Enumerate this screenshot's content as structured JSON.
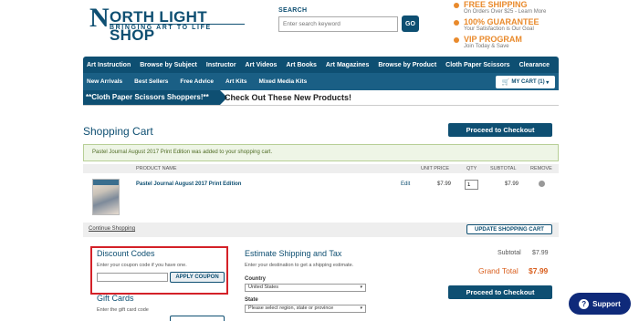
{
  "header": {
    "logo_letter": "N",
    "logo_title": "ORTH LIGHT SHOP",
    "logo_tagline": "BRINGING ART TO LIFE",
    "search_label": "SEARCH",
    "search_placeholder": "Enter search keyword",
    "search_button": "GO"
  },
  "promos": [
    {
      "title": "FREE SHIPPING",
      "sub": "On Orders Over $25 - Learn More"
    },
    {
      "title": "100% GUARANTEE",
      "sub": "Your Satisfaction is Our Goal"
    },
    {
      "title": "VIP PROGRAM",
      "sub": "Join Today & Save"
    }
  ],
  "nav_primary": [
    "Art Instruction",
    "Browse by Subject",
    "Instructor",
    "Art Videos",
    "Art Books",
    "Art Magazines",
    "Browse by Product",
    "Cloth Paper Scissors",
    "Clearance"
  ],
  "nav_secondary": [
    "New Arrivals",
    "Best Sellers",
    "Free Advice",
    "Art Kits",
    "Mixed Media Kits"
  ],
  "cart_link": "MY CART (1)",
  "banner": {
    "tag": "**Cloth Paper Scissors Shoppers!**",
    "text": "Check Out These New Products!"
  },
  "cart": {
    "title": "Shopping Cart",
    "checkout_label": "Proceed to Checkout",
    "notice": "Pastel Journal August 2017 Print Edition was added to your shopping cart.",
    "headers": {
      "product": "PRODUCT NAME",
      "unit_price": "UNIT PRICE",
      "qty": "QTY",
      "subtotal": "SUBTOTAL",
      "remove": "REMOVE"
    },
    "items": [
      {
        "name": "Pastel Journal August 2017 Print Edition",
        "edit": "Edit",
        "price": "$7.99",
        "qty": "1",
        "subtotal": "$7.99"
      }
    ],
    "continue_label": "Continue Shopping",
    "update_label": "UPDATE SHOPPING CART"
  },
  "discount": {
    "title": "Discount Codes",
    "sub": "Enter your coupon code if you have one.",
    "apply_label": "APPLY COUPON"
  },
  "gift": {
    "title": "Gift Cards",
    "sub": "Enter the gift card code"
  },
  "shipping": {
    "title": "Estimate Shipping and Tax",
    "sub": "Enter your destination to get a shipping estimate.",
    "country_label": "Country",
    "country_value": "United States",
    "state_label": "State",
    "state_value": "Please select region, state or province"
  },
  "totals": {
    "subtotal_label": "Subtotal",
    "subtotal_value": "$7.99",
    "grand_label": "Grand Total",
    "grand_value": "$7.99"
  },
  "support_label": "Support",
  "colors": {
    "brand_blue": "#0e4f72",
    "accent_orange": "#e98a2c",
    "highlight_red": "#d42128",
    "support_navy": "#0f2a7a"
  }
}
